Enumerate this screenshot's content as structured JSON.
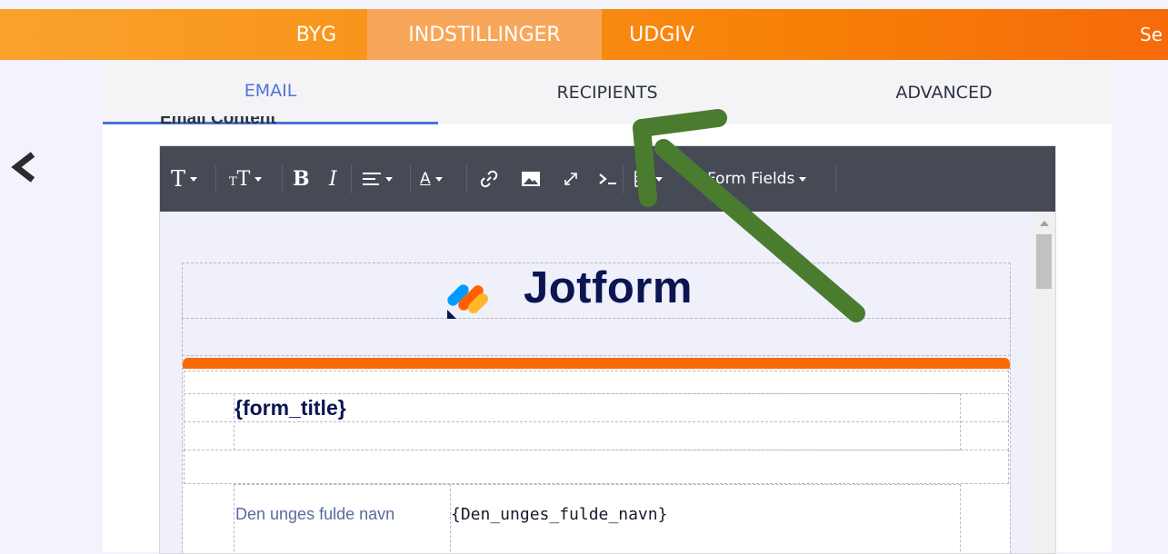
{
  "top_nav": {
    "byg": "BYG",
    "indstillinger": "INDSTILLINGER",
    "udgiv": "UDGIV",
    "se": "Se"
  },
  "tabs": [
    {
      "label": "EMAIL",
      "active": true
    },
    {
      "label": "RECIPIENTS",
      "active": false
    },
    {
      "label": "ADVANCED",
      "active": false
    }
  ],
  "section_label": "Email Content",
  "toolbar": {
    "text_icon": "T",
    "text_size_icon": "TT",
    "bold": "B",
    "italic": "I",
    "form_fields_label": "Form Fields"
  },
  "email": {
    "logo_text": "Jotform",
    "form_title": "{form_title}",
    "field_label": "Den unges fulde navn",
    "field_value": "{Den_unges_fulde_navn}"
  },
  "colors": {
    "accent_orange": "#f77f07",
    "active_tab_blue": "#4f73d9",
    "toolbar_bg": "#454a55",
    "arrow_green": "#4a7c2f"
  }
}
